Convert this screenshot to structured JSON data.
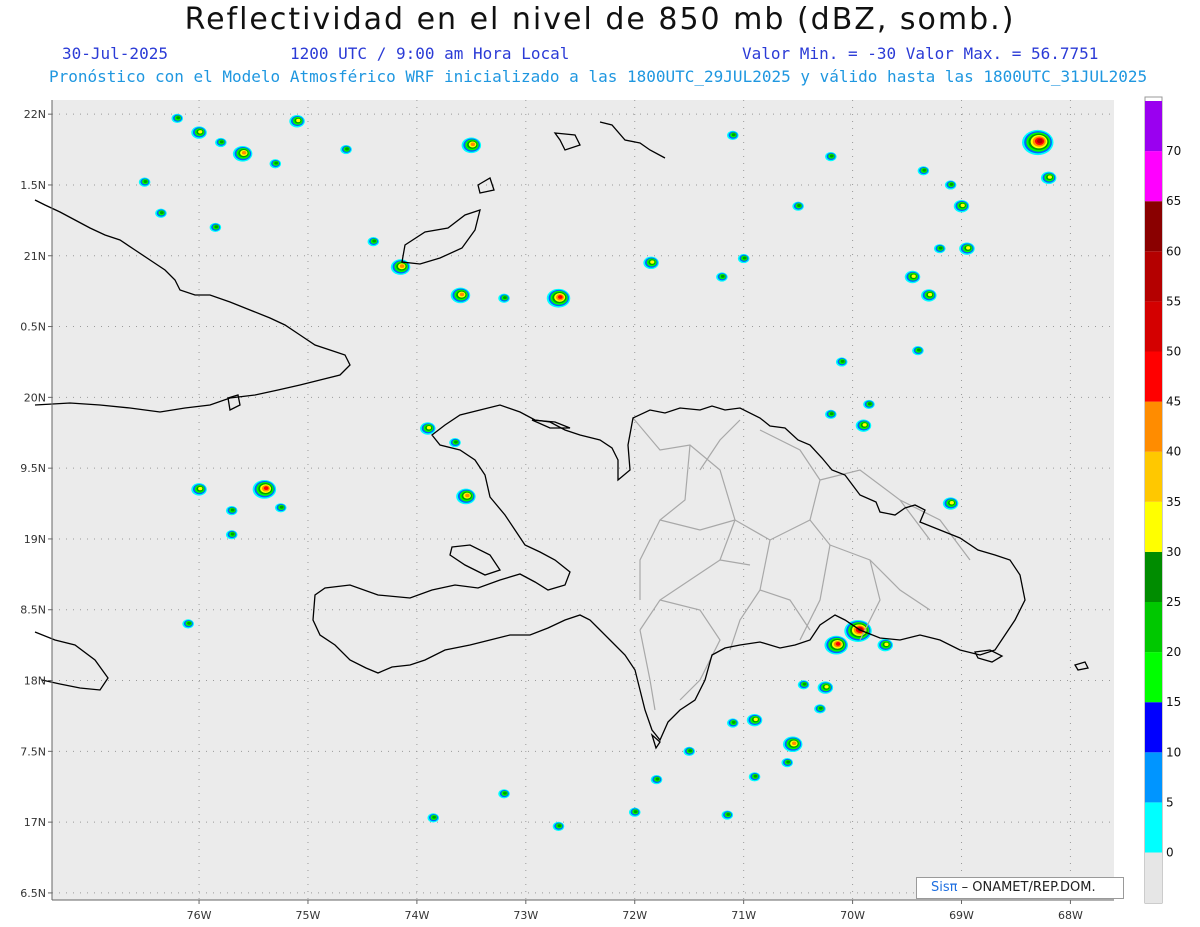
{
  "header": {
    "title": "Reflectividad en el nivel de 850 mb (dBZ, somb.)",
    "date": "30-Jul-2025",
    "time": "1200 UTC / 9:00 am Hora Local",
    "stats": "Valor Min. = -30  Valor Max. = 56.7751",
    "subtitle": "Pronóstico con el Modelo Atmosférico WRF inicializado a las 1800UTC_29JUL2025 y válido hasta las  1800UTC_31JUL2025"
  },
  "map": {
    "lon_range": [
      -77.35,
      -67.6
    ],
    "lat_range": [
      16.45,
      22.1
    ],
    "x_ticks": [
      {
        "lon": -76,
        "label": "76W"
      },
      {
        "lon": -75,
        "label": "75W"
      },
      {
        "lon": -74,
        "label": "74W"
      },
      {
        "lon": -73,
        "label": "73W"
      },
      {
        "lon": -72,
        "label": "72W"
      },
      {
        "lon": -71,
        "label": "71W"
      },
      {
        "lon": -70,
        "label": "70W"
      },
      {
        "lon": -69,
        "label": "69W"
      },
      {
        "lon": -68,
        "label": "68W"
      }
    ],
    "y_ticks": [
      {
        "lat": 22,
        "label": "22N"
      },
      {
        "lat": 21.5,
        "label": "1.5N"
      },
      {
        "lat": 21,
        "label": "21N"
      },
      {
        "lat": 20.5,
        "label": "0.5N"
      },
      {
        "lat": 20,
        "label": "20N"
      },
      {
        "lat": 19.5,
        "label": "9.5N"
      },
      {
        "lat": 19,
        "label": "19N"
      },
      {
        "lat": 18.5,
        "label": "8.5N"
      },
      {
        "lat": 18,
        "label": "18N"
      },
      {
        "lat": 17.5,
        "label": "7.5N"
      },
      {
        "lat": 17,
        "label": "17N"
      },
      {
        "lat": 16.5,
        "label": "6.5N"
      }
    ],
    "background_color": "#ebebeb",
    "coast_color": "#000000",
    "province_color": "#a8a8a8",
    "echoes": [
      [
        -76.2,
        21.97,
        1
      ],
      [
        -76.0,
        21.87,
        2
      ],
      [
        -75.8,
        21.8,
        1
      ],
      [
        -75.6,
        21.72,
        3
      ],
      [
        -75.3,
        21.65,
        1
      ],
      [
        -75.1,
        21.95,
        2
      ],
      [
        -74.65,
        21.75,
        1
      ],
      [
        -73.5,
        21.78,
        3
      ],
      [
        -76.5,
        21.52,
        1
      ],
      [
        -76.35,
        21.3,
        1
      ],
      [
        -75.85,
        21.2,
        1
      ],
      [
        -74.4,
        21.1,
        1
      ],
      [
        -74.15,
        20.92,
        3
      ],
      [
        -73.6,
        20.72,
        3
      ],
      [
        -73.2,
        20.7,
        1
      ],
      [
        -72.7,
        20.7,
        4
      ],
      [
        -71.85,
        20.95,
        2
      ],
      [
        -71.2,
        20.85,
        1
      ],
      [
        -71.0,
        20.98,
        1
      ],
      [
        -70.5,
        21.35,
        1
      ],
      [
        -70.2,
        21.7,
        1
      ],
      [
        -71.1,
        21.85,
        1
      ],
      [
        -69.35,
        21.6,
        1
      ],
      [
        -69.1,
        21.5,
        1
      ],
      [
        -69.0,
        21.35,
        2
      ],
      [
        -68.95,
        21.05,
        2
      ],
      [
        -69.2,
        21.05,
        1
      ],
      [
        -69.45,
        20.85,
        2
      ],
      [
        -69.3,
        20.72,
        2
      ],
      [
        -69.4,
        20.33,
        1
      ],
      [
        -70.1,
        20.25,
        1
      ],
      [
        -69.85,
        19.95,
        1
      ],
      [
        -69.9,
        19.8,
        2
      ],
      [
        -70.2,
        19.88,
        1
      ],
      [
        -73.9,
        19.78,
        2
      ],
      [
        -73.65,
        19.68,
        1
      ],
      [
        -73.55,
        19.3,
        3
      ],
      [
        -76.0,
        19.35,
        2
      ],
      [
        -75.7,
        19.2,
        1
      ],
      [
        -75.4,
        19.35,
        4
      ],
      [
        -75.25,
        19.22,
        1
      ],
      [
        -75.7,
        19.03,
        1
      ],
      [
        -69.1,
        19.25,
        2
      ],
      [
        -70.15,
        18.25,
        4
      ],
      [
        -69.95,
        18.35,
        5
      ],
      [
        -69.7,
        18.25,
        2
      ],
      [
        -70.25,
        17.95,
        2
      ],
      [
        -70.3,
        17.8,
        1
      ],
      [
        -70.9,
        17.72,
        2
      ],
      [
        -70.55,
        17.55,
        3
      ],
      [
        -70.6,
        17.42,
        1
      ],
      [
        -71.1,
        17.7,
        1
      ],
      [
        -70.9,
        17.32,
        1
      ],
      [
        -71.15,
        17.05,
        1
      ],
      [
        -72.0,
        17.07,
        1
      ],
      [
        -72.7,
        16.97,
        1
      ],
      [
        -73.2,
        17.2,
        1
      ],
      [
        -73.85,
        17.03,
        1
      ],
      [
        -76.1,
        18.4,
        1
      ],
      [
        -68.3,
        21.8,
        6
      ],
      [
        -68.2,
        21.55,
        2
      ],
      [
        -70.45,
        17.97,
        1
      ],
      [
        -71.5,
        17.5,
        1
      ],
      [
        -71.8,
        17.3,
        1
      ]
    ]
  },
  "colorbar": {
    "levels": [
      0,
      5,
      10,
      15,
      20,
      25,
      30,
      35,
      40,
      45,
      50,
      55,
      60,
      65,
      70
    ],
    "labels": [
      "0",
      "5",
      "10",
      "15",
      "20",
      "25",
      "30",
      "35",
      "40",
      "45",
      "50",
      "55",
      "60",
      "65",
      "70"
    ],
    "colors": [
      "#00ffff",
      "#0095ff",
      "#0000ff",
      "#00ff00",
      "#00c800",
      "#008c00",
      "#ffff00",
      "#ffc800",
      "#ff8c00",
      "#ff0000",
      "#d40000",
      "#b40000",
      "#8a0000",
      "#ff00ff",
      "#9a00f0"
    ]
  },
  "credit": {
    "logo": "Sisπ",
    "org": "– ONAMET/REP.DOM."
  }
}
